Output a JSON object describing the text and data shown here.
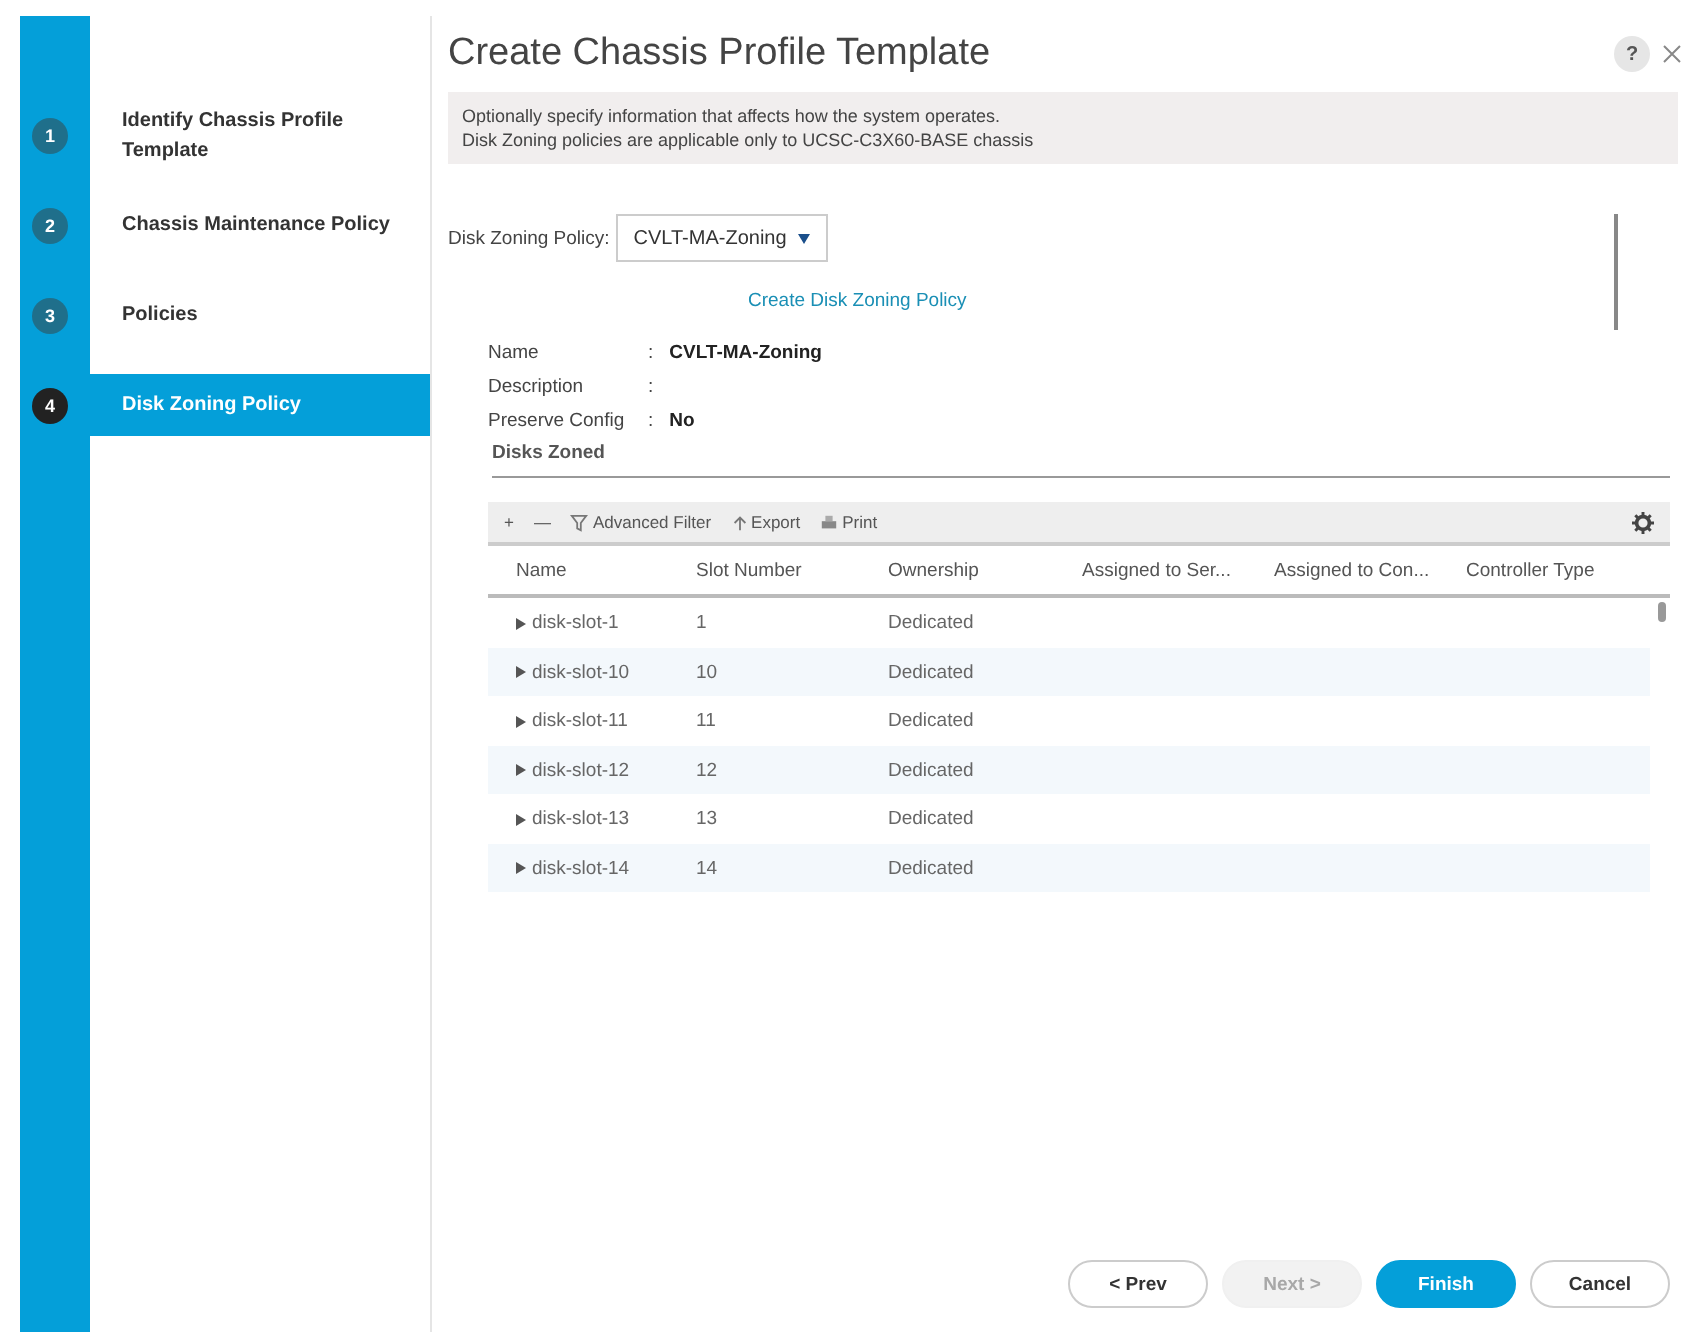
{
  "steps": [
    {
      "number": "1",
      "label": "Identify Chassis Profile Template",
      "selected": false
    },
    {
      "number": "2",
      "label": "Chassis Maintenance Policy",
      "selected": false
    },
    {
      "number": "3",
      "label": "Policies",
      "selected": false
    },
    {
      "number": "4",
      "label": "Disk Zoning Policy",
      "selected": true
    }
  ],
  "title": "Create Chassis Profile Template",
  "help": "?",
  "info": [
    "Optionally specify information that affects how the system operates.",
    "Disk Zoning policies are applicable only to UCSC-C3X60-BASE chassis"
  ],
  "policy_select": {
    "label": "Disk Zoning Policy:",
    "value": "CVLT-MA-Zoning"
  },
  "create_link": "Create Disk Zoning Policy",
  "details": [
    {
      "label": "Name",
      "separator": ":",
      "value": "CVLT-MA-Zoning"
    },
    {
      "label": "Description",
      "separator": ":"
    },
    {
      "label": "Preserve Config",
      "separator": ":",
      "value": "No"
    }
  ],
  "section_title": "Disks Zoned",
  "toolbar": [
    {
      "kind": "add",
      "label": "+"
    },
    {
      "kind": "remove",
      "label": "—"
    },
    {
      "kind": "filter",
      "label": "Advanced Filter"
    },
    {
      "kind": "export",
      "label": "Export"
    },
    {
      "kind": "print",
      "label": "Print"
    }
  ],
  "table": {
    "columns": [
      "Name",
      "Slot Number",
      "Ownership",
      "Assigned to Ser...",
      "Assigned to Con...",
      "Controller Type"
    ],
    "rows": [
      [
        "disk-slot-1",
        "1",
        "Dedicated"
      ],
      [
        "disk-slot-10",
        "10",
        "Dedicated"
      ],
      [
        "disk-slot-11",
        "11",
        "Dedicated"
      ],
      [
        "disk-slot-12",
        "12",
        "Dedicated"
      ],
      [
        "disk-slot-13",
        "13",
        "Dedicated"
      ],
      [
        "disk-slot-14",
        "14",
        "Dedicated"
      ]
    ]
  },
  "buttons": [
    {
      "label": "< Prev",
      "kind": "normal",
      "disabled": false
    },
    {
      "label": "Next >",
      "kind": "normal",
      "disabled": true
    },
    {
      "label": "Finish",
      "kind": "primary",
      "disabled": false
    },
    {
      "label": "Cancel",
      "kind": "normal",
      "disabled": false
    }
  ]
}
